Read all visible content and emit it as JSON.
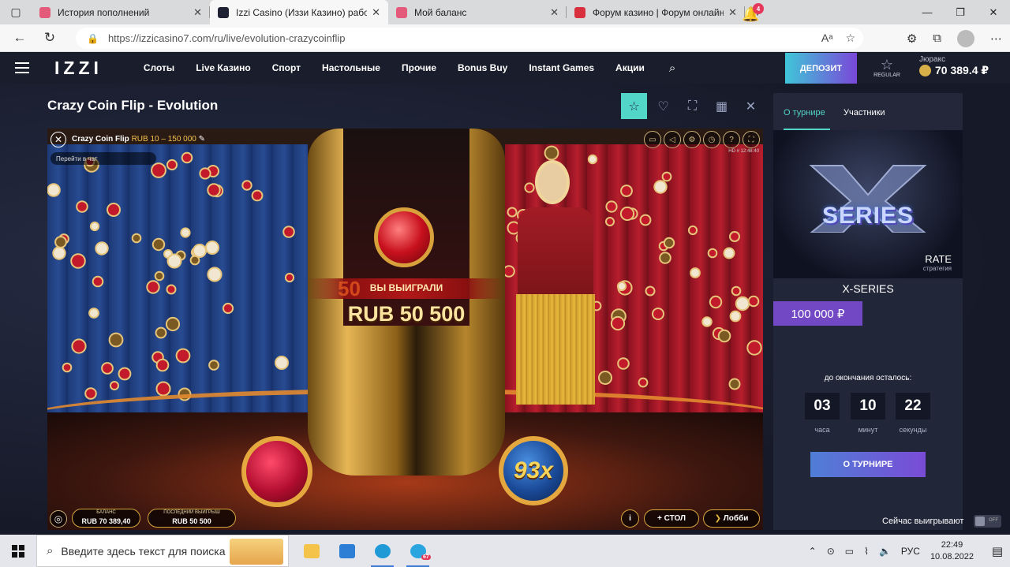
{
  "browser": {
    "tabs": [
      {
        "title": "История пополнений",
        "favicon_color": "#e45a7a",
        "active": false
      },
      {
        "title": "Izzi Casino (Иззи Казино) рабо‹",
        "favicon_color": "#1d2133",
        "active": true
      },
      {
        "title": "Мой баланс",
        "favicon_color": "#e45a7a",
        "active": false
      },
      {
        "title": "Форум казино | Форум онлайн",
        "favicon_color": "#d9303e",
        "active": false
      }
    ],
    "url": "https://izzicasino7.com/ru/live/evolution-crazycoinflip"
  },
  "site": {
    "logo": "IZZI",
    "menu": [
      "Слоты",
      "Live Казино",
      "Спорт",
      "Настольные",
      "Прочие",
      "Bonus Buy",
      "Instant Games",
      "Акции"
    ],
    "notifications_count": "4",
    "deposit_label": "ДЕПОЗИТ",
    "status_label": "REGULAR",
    "currency_label": "Jюракс",
    "balance": "70 389.4 ₽",
    "accent_color": "#52d6c7"
  },
  "game": {
    "title": "Crazy Coin Flip - Evolution",
    "overlay_name": "Crazy Coin Flip",
    "limits": "RUB 10 – 150 000",
    "chat_label": "Перейти в чат",
    "hd_info": "HD  # 12:48:40",
    "win_label": "ВЫ ВЫИГРАЛИ",
    "win_multiplier": "50",
    "win_amount": "RUB 50 500",
    "coin_multiplier": "93x",
    "balance_label": "БАЛАНС",
    "balance_value": "RUB 70 389,40",
    "last_win_label": "ПОСЛЕДНИЙ ВЫИГРЫШ",
    "last_win_value": "RUB 50 500",
    "table_btn": "СТОЛ",
    "lobby_btn": "Лобби"
  },
  "tournament": {
    "tabs": [
      "О турнире",
      "Участники"
    ],
    "banner_title": "SERIES",
    "rate": "RATE",
    "rate_sub": "стратегия",
    "name": "X-SERIES",
    "prize": "100 000 ₽",
    "time_left_label": "до окончания осталось:",
    "countdown": [
      {
        "value": "03",
        "unit": "часа"
      },
      {
        "value": "10",
        "unit": "минут"
      },
      {
        "value": "22",
        "unit": "секунды"
      }
    ],
    "button": "О ТУРНИРЕ",
    "now_winning": "Сейчас выигрывают",
    "toggle_state": "OFF"
  },
  "taskbar": {
    "search_placeholder": "Введите здесь текст для поиска",
    "telegram_badge": "67",
    "lang": "РУС",
    "time": "22:49",
    "date": "10.08.2022"
  }
}
